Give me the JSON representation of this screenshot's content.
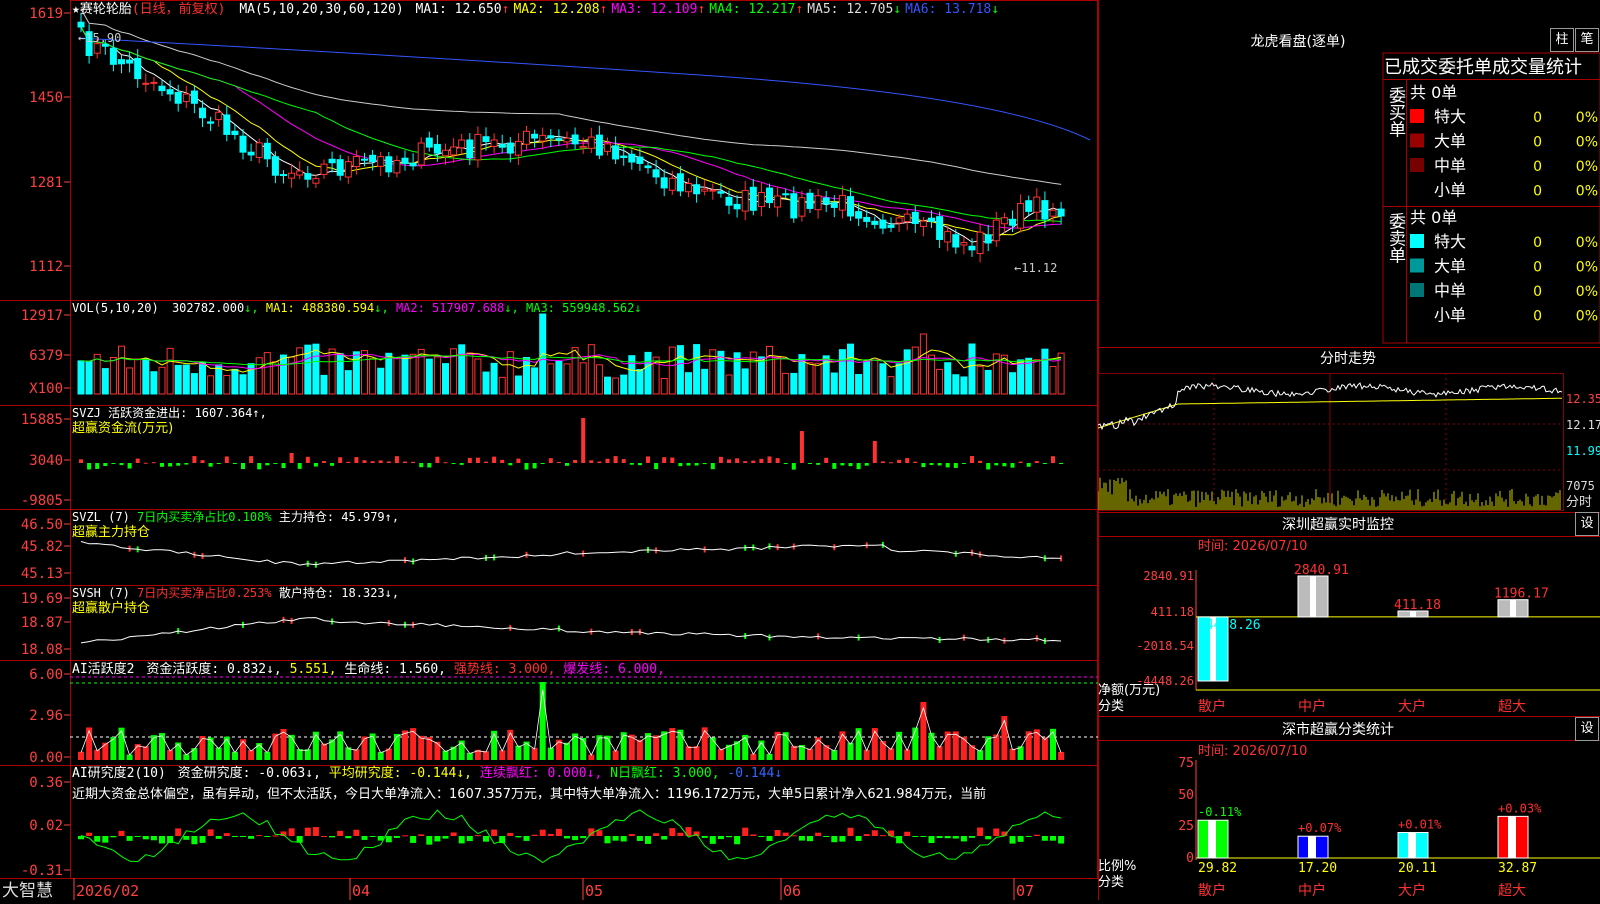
{
  "stock": {
    "name": "★赛轮轮胎",
    "mode": "(日线，前复权)",
    "ma_caption": "MA(5,10,20,30,60,120)",
    "ma_values": [
      {
        "label": "MA1:",
        "value": "12.650",
        "arrow": "↑",
        "color": "#ffffff"
      },
      {
        "label": "MA2:",
        "value": "12.208",
        "arrow": "↑",
        "color": "#ffff00"
      },
      {
        "label": "MA3:",
        "value": "12.109",
        "arrow": "↑",
        "color": "#ff00ff"
      },
      {
        "label": "MA4:",
        "value": "12.217",
        "arrow": "↑",
        "color": "#00ff00"
      },
      {
        "label": "MA5:",
        "value": "12.705",
        "arrow": "↓",
        "color": "#dddddd"
      },
      {
        "label": "MA6:",
        "value": "13.718",
        "arrow": "↓",
        "color": "#3355ff"
      }
    ],
    "price_ticks": [
      "1619",
      "1450",
      "1281",
      "1112"
    ],
    "high_label": "15.90",
    "low_label": "11.12"
  },
  "vol": {
    "caption": "VOL(5,10,20)",
    "value": "302782.000",
    "ma1": "MA1: 488380.594",
    "ma2": "MA2: 517907.688",
    "ma3": "MA3: 559948.562",
    "ticks": [
      "12917",
      "6379",
      "X100"
    ]
  },
  "svzj": {
    "caption": "SVZJ  活跃资金进出: 1607.364↑,",
    "sub": "超赢资金流(万元)",
    "ticks": [
      "15885",
      "3040",
      "-9805"
    ]
  },
  "svzl": {
    "caption": "SVZL (7)",
    "part2": "7日内买卖净占比0.108%",
    "part3": "主力持仓: 45.979↑,",
    "sub": "超赢主力持仓",
    "ticks": [
      "46.50",
      "45.82",
      "45.13"
    ]
  },
  "svsh": {
    "caption": "SVSH (7)",
    "part2": "7日内买卖净占比0.253%",
    "part3": "散户持仓: 18.323↓,",
    "sub": "超赢散户持仓",
    "ticks": [
      "19.69",
      "18.87",
      "18.08"
    ]
  },
  "ai1": {
    "caption": "AI活跃度2",
    "p1": "资金活跃度: 0.832↓,",
    "p2": "5.551,",
    "p3": "生命线: 1.560,",
    "p4": "强势线: 3.000,",
    "p5": "爆发线: 6.000,",
    "ticks": [
      "6.00",
      "2.96",
      "0.00"
    ]
  },
  "ai2": {
    "caption": "AI研究度2(10)",
    "p1": "资金研究度: -0.063↓,",
    "p2": "平均研究度: -0.144↓,",
    "p3": "连续飘红: 0.000↓,",
    "p4": "N日飘红: 3.000,",
    "p5": "-0.144↓",
    "comment": "近期大资金总体偏空，虽有异动，但不太活跃，今日大单净流入：1607.357万元，其中特大单净流入：1196.172万元，大单5日累计净入621.984万元，当前",
    "ticks": [
      "0.36",
      "0.02",
      "-0.31"
    ]
  },
  "xaxis": {
    "brand": "大智慧",
    "labels": [
      "2026/02",
      "04",
      "05",
      "06",
      "07"
    ]
  },
  "side": {
    "lhb_title": "龙虎看盘(逐单)",
    "btn1": "柱",
    "btn2": "笔",
    "table_title": "已成交委托单成交量统计",
    "buy_label": "委买单",
    "sell_label": "委卖单",
    "buy_total": "共 0单",
    "sell_total": "共 0单",
    "buy_rows": [
      {
        "name": "特大",
        "count": "0",
        "pct": "0%",
        "color": "#ff0000"
      },
      {
        "name": "大单",
        "count": "0",
        "pct": "0%",
        "color": "#990000"
      },
      {
        "name": "中单",
        "count": "0",
        "pct": "0%",
        "color": "#770000"
      },
      {
        "name": "小单",
        "count": "0",
        "pct": "0%",
        "color": "#000000"
      }
    ],
    "sell_rows": [
      {
        "name": "特大",
        "count": "0",
        "pct": "0%",
        "color": "#00ffff"
      },
      {
        "name": "大单",
        "count": "0",
        "pct": "0%",
        "color": "#009999"
      },
      {
        "name": "中单",
        "count": "0",
        "pct": "0%",
        "color": "#007777"
      },
      {
        "name": "小单",
        "count": "0",
        "pct": "0%",
        "color": "#000000"
      }
    ],
    "fs_title": "分时走势",
    "fs_ticks": [
      "12.35",
      "12.17",
      "11.99"
    ],
    "fs_vol_tick": "7075",
    "fs_vol_label": "分时",
    "mon_title": "深圳超赢实时监控",
    "mon_set": "设",
    "mon_time": "时间: 2026/07/10",
    "mon_ticks": [
      "2840.91",
      "411.18",
      "-2018.54",
      "-4448.26"
    ],
    "mon_ylabel1": "净额(万元)",
    "mon_ylabel2": "分类",
    "cls_title": "深市超赢分类统计",
    "cls_set": "设",
    "cls_time": "时间: 2026/07/10",
    "cls_ticks": [
      "75",
      "50",
      "25",
      "0"
    ],
    "cls_ylabel1": "比例%",
    "cls_ylabel2": "分类"
  },
  "chart_data": [
    {
      "type": "line",
      "title": "分时走势",
      "ylim": [
        11.99,
        12.35
      ],
      "series": []
    },
    {
      "type": "bar",
      "title": "深圳超赢实时监控",
      "categories": [
        "散户",
        "中户",
        "大户",
        "超大"
      ],
      "values": [
        -4448.26,
        2840.91,
        411.18,
        1196.17
      ],
      "value_labels": [
        "-4448.26",
        "2840.91",
        "411.18",
        "1196.17"
      ],
      "ylim": [
        -4448.26,
        2840.91
      ],
      "colors": [
        "#00ffff",
        "#ff0000",
        "#ff0000",
        "#ff0000"
      ]
    },
    {
      "type": "bar",
      "title": "深市超赢分类统计",
      "categories": [
        "散户",
        "中户",
        "大户",
        "超大"
      ],
      "values": [
        29.82,
        17.2,
        20.11,
        32.87
      ],
      "value_labels": [
        "29.82",
        "17.20",
        "20.11",
        "32.87"
      ],
      "change_labels": [
        "-0.11%",
        "+0.07%",
        "+0.01%",
        "+0.03%"
      ],
      "ylim": [
        0,
        75
      ],
      "colors": [
        "#00ff00",
        "#0000ff",
        "#00ffff",
        "#ff0000"
      ]
    }
  ],
  "colors": {
    "up": "#ff3232",
    "down": "#00ffff",
    "grid": "#880000",
    "text_axis": "#ff4040"
  }
}
